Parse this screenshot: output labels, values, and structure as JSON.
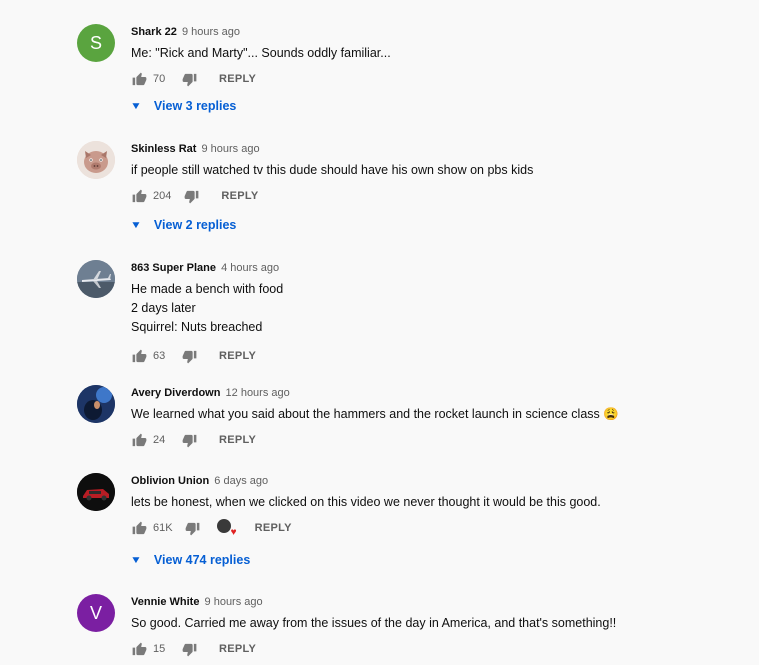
{
  "colors": {
    "link": "#065fd4",
    "muted": "#606060",
    "heart": "#e02222"
  },
  "actions": {
    "reply_label": "REPLY"
  },
  "comments": [
    {
      "author": "Shark 22",
      "time": "9 hours ago",
      "avatar_letter": "S",
      "avatar_color": "#5aa43f",
      "text": [
        "Me: \"Rick and Marty\"... Sounds oddly familiar..."
      ],
      "likes": "70",
      "view_replies": "View 3 replies"
    },
    {
      "author": "Skinless Rat",
      "time": "9 hours ago",
      "avatar_icon": "pig-avatar-icon",
      "text": [
        "if people still watched tv this dude should have his own show on pbs kids"
      ],
      "likes": "204",
      "view_replies": "View 2 replies"
    },
    {
      "author": "863 Super Plane",
      "time": "4 hours ago",
      "avatar_icon": "airplane-avatar-icon",
      "text": [
        "He made a bench with food",
        "2 days later",
        "Squirrel: Nuts breached"
      ],
      "likes": "63"
    },
    {
      "author": "Avery Diverdown",
      "time": "12 hours ago",
      "avatar_icon": "photo-avatar-icon",
      "text": [
        "We learned what you said about the hammers and the rocket launch in science class 😩"
      ],
      "likes": "24"
    },
    {
      "author": "Oblivion Union",
      "time": "6 days ago",
      "avatar_icon": "car-avatar-icon",
      "text": [
        "lets be honest, when we clicked on this video we never thought it would be this good."
      ],
      "likes": "61K",
      "creator_heart": true,
      "view_replies": "View 474 replies"
    },
    {
      "author": "Vennie White",
      "time": "9 hours ago",
      "avatar_letter": "V",
      "avatar_color": "#7b1fa2",
      "text": [
        "So good. Carried me away from the issues of the day in America, and that's something!!"
      ],
      "likes": "15"
    }
  ]
}
